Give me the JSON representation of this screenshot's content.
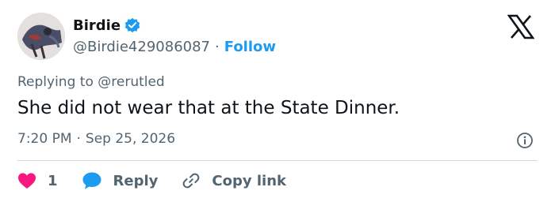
{
  "author": {
    "display_name": "Birdie",
    "handle": "@Birdie429086087",
    "separator": "·",
    "follow_label": "Follow",
    "verified": true
  },
  "reply": {
    "prefix": "Replying to",
    "mention": "@rerutled"
  },
  "tweet_text": "She did not wear that at the State Dinner.",
  "meta": {
    "time": "7:20 PM",
    "separator": "·",
    "date": "Sep 25, 2026"
  },
  "actions": {
    "like_count": "1",
    "reply_label": "Reply",
    "copy_link_label": "Copy link"
  },
  "colors": {
    "accent": "#1d9bf0",
    "like": "#f91880",
    "text": "#0f1419",
    "secondary": "#536471",
    "divider": "#cfd9de"
  },
  "icons": {
    "verified": "verified-badge-icon",
    "platform": "x-logo-icon",
    "info": "info-icon",
    "like": "heart-icon",
    "reply": "speech-bubble-icon",
    "copy_link": "link-icon"
  }
}
